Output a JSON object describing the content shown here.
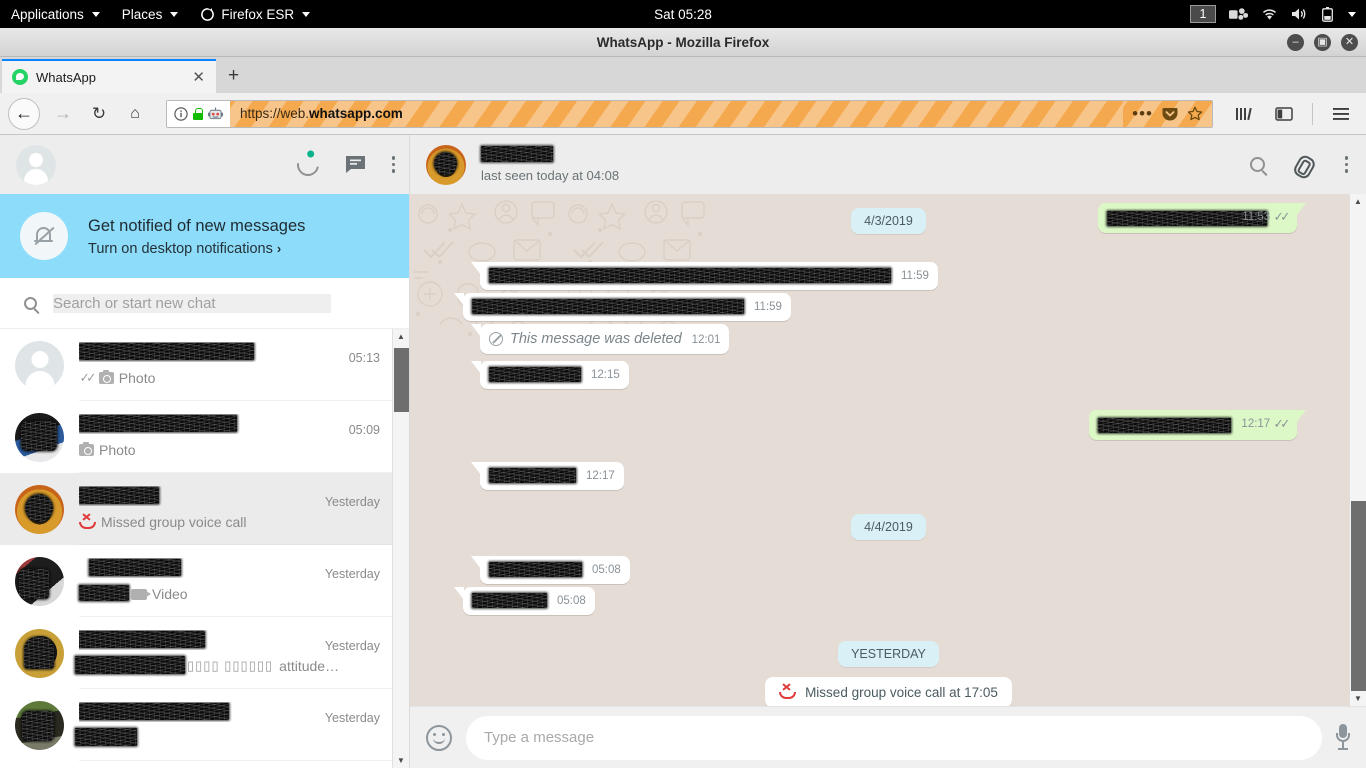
{
  "desktop": {
    "menu": [
      {
        "label": "Applications",
        "caret": true,
        "icon": null
      },
      {
        "label": "Places",
        "caret": true,
        "icon": null
      },
      {
        "label": "Firefox ESR",
        "caret": true,
        "icon": "firefox-icon"
      }
    ],
    "clock": "Sat 05:28",
    "workspace": "1",
    "tray_icons": [
      "screencast-icon",
      "wifi-icon",
      "volume-icon",
      "battery-icon",
      "system-menu-caret"
    ]
  },
  "browser": {
    "window_title": "WhatsApp - Mozilla Firefox",
    "window_buttons": {
      "minimize": "–",
      "maximize": "▣",
      "close": "✕"
    },
    "tab": {
      "label": "WhatsApp",
      "close": "✕",
      "favicon": "whatsapp-favicon"
    },
    "new_tab": "+",
    "nav": {
      "back": "←",
      "forward": "→",
      "reload": "↻",
      "home": "⌂"
    },
    "url": {
      "prefix": "https://web.",
      "domain": "whatsapp.com",
      "full": "https://web.whatsapp.com",
      "identity_icons": [
        "info-icon",
        "lock-icon",
        "robot-icon"
      ],
      "actions": [
        "page-actions-icon",
        "pocket-icon",
        "bookmark-star-icon"
      ]
    },
    "toolbar_right": [
      "library-icon",
      "sidebar-icon",
      "hamburger-menu-icon"
    ]
  },
  "whatsapp": {
    "sidebar": {
      "header_icons": [
        "status-icon",
        "new-chat-icon",
        "menu-icon"
      ],
      "notification": {
        "title": "Get notified of new messages",
        "link": "Turn on desktop notifications",
        "chevron": "›",
        "bg_color": "#8ddcfa",
        "icon": "bell-off-icon"
      },
      "search": {
        "placeholder": "Search or start new chat",
        "icon": "search-icon"
      },
      "chats": [
        {
          "name_redacted": true,
          "name_width": 175,
          "time": "05:13",
          "preview": "Photo",
          "preview_icon": "camera-icon",
          "ticks": true,
          "avatar": "default-avatar",
          "active": false
        },
        {
          "name_redacted": true,
          "name_width": 158,
          "time": "05:09",
          "preview": "Photo",
          "preview_icon": "camera-icon",
          "ticks": false,
          "avatar": "photo-avatar-1",
          "active": false
        },
        {
          "name_redacted": true,
          "name_width": 80,
          "time": "Yesterday",
          "preview": "Missed group voice call",
          "preview_icon": "missed-call-icon",
          "ticks": false,
          "avatar": "photo-avatar-2",
          "active": true
        },
        {
          "name_redacted": true,
          "name_width": 92,
          "time": "Yesterday",
          "preview": "Video",
          "preview_icon": "video-icon",
          "ticks": false,
          "avatar": "photo-avatar-3",
          "active": false
        },
        {
          "name_redacted": true,
          "name_width": 130,
          "time": "Yesterday",
          "preview": "attitude…",
          "preview_icon": null,
          "ticks": false,
          "avatar": "photo-avatar-4",
          "active": false
        },
        {
          "name_redacted": true,
          "name_width": 168,
          "time": "Yesterday",
          "preview": "",
          "preview_icon": null,
          "ticks": false,
          "avatar": "photo-avatar-5",
          "active": false
        }
      ]
    },
    "chat": {
      "header": {
        "name_redacted": true,
        "status": "last seen today at 04:08",
        "icons": [
          "search-icon",
          "attach-icon",
          "menu-icon"
        ]
      },
      "messages": [
        {
          "kind": "date",
          "text": "4/3/2019"
        },
        {
          "kind": "msg",
          "dir": "out",
          "redact_w": 160,
          "time": "11:53",
          "ticks": true,
          "top": true
        },
        {
          "kind": "msg",
          "dir": "in",
          "redact_w": 402,
          "time": "11:59",
          "ticks": false
        },
        {
          "kind": "msg",
          "dir": "in",
          "redact_w": 272,
          "time": "11:59",
          "ticks": false
        },
        {
          "kind": "deleted",
          "dir": "in",
          "text": "This message was deleted",
          "time": "12:01",
          "icon": "blocked-icon"
        },
        {
          "kind": "msg",
          "dir": "in",
          "redact_w": 92,
          "time": "12:15",
          "ticks": false
        },
        {
          "kind": "msg",
          "dir": "out",
          "redact_w": 133,
          "time": "12:17",
          "ticks": true
        },
        {
          "kind": "msg",
          "dir": "in",
          "redact_w": 87,
          "time": "12:17",
          "ticks": false
        },
        {
          "kind": "date",
          "text": "4/4/2019"
        },
        {
          "kind": "msg",
          "dir": "in",
          "redact_w": 93,
          "time": "05:08",
          "ticks": false
        },
        {
          "kind": "msg",
          "dir": "in",
          "redact_w": 75,
          "time": "05:08",
          "ticks": false
        },
        {
          "kind": "date",
          "text": "YESTERDAY"
        },
        {
          "kind": "system",
          "text": "Missed group voice call at 17:05",
          "icon": "missed-call-icon"
        }
      ],
      "composer": {
        "placeholder": "Type a message",
        "emoji_icon": "smiley-icon",
        "mic_icon": "microphone-icon"
      },
      "colors": {
        "incoming_bubble": "#ffffff",
        "outgoing_bubble": "#dcf8c6",
        "wallpaper": "#e5ddd5",
        "date_chip": "#d9f0f7"
      }
    }
  }
}
